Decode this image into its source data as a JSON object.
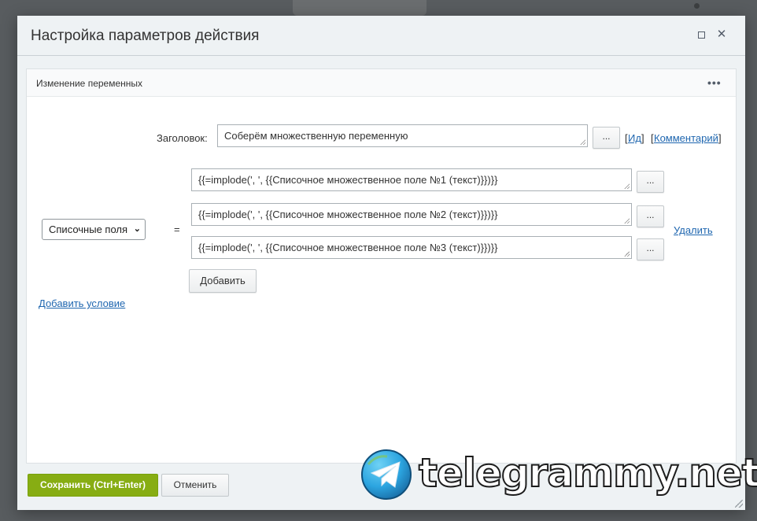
{
  "dialog": {
    "title": "Настройка параметров действия"
  },
  "panel": {
    "title": "Изменение переменных"
  },
  "heading_field": {
    "label": "Заголовок:",
    "value": "Соберём множественную переменную",
    "browse_label": "...",
    "id_bracket_open": "[",
    "id_link": "Ид",
    "id_bracket_close": "]",
    "comment_bracket_open": "[",
    "comment_link": "Комментарий",
    "comment_bracket_close": "]"
  },
  "condition": {
    "select_value": "Списочные поля",
    "equals": "=",
    "values": [
      {
        "text": "{{=implode(', ', {{Списочное множественное поле №1 (текст)}})}}",
        "browse_label": "..."
      },
      {
        "text": "{{=implode(', ', {{Списочное множественное поле №2 (текст)}})}}",
        "browse_label": "..."
      },
      {
        "text": "{{=implode(', ', {{Списочное множественное поле №3 (текст)}})}}",
        "browse_label": "..."
      }
    ],
    "delete_link": "Удалить",
    "add_button": "Добавить"
  },
  "add_condition_link": "Добавить условие",
  "footer": {
    "save_button": "Сохранить (Ctrl+Enter)",
    "cancel_button": "Отменить"
  },
  "watermark": {
    "text": "telegrammy.net"
  },
  "colors": {
    "accent_green": "#87ad13",
    "link_blue": "#2067b0",
    "telegram_blue": "#2ca5e0"
  }
}
